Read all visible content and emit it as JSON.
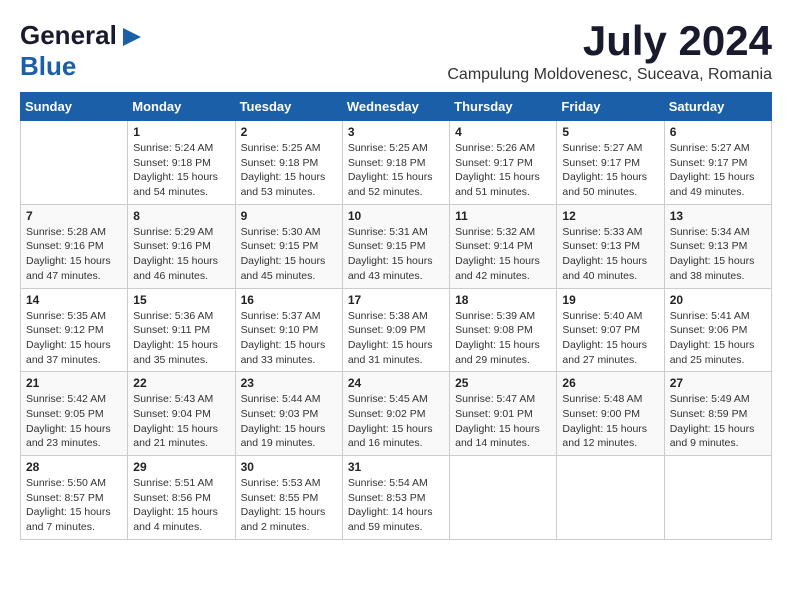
{
  "header": {
    "logo_general": "General",
    "logo_blue": "Blue",
    "title": "July 2024",
    "subtitle": "Campulung Moldovenesc, Suceava, Romania"
  },
  "calendar": {
    "days_of_week": [
      "Sunday",
      "Monday",
      "Tuesday",
      "Wednesday",
      "Thursday",
      "Friday",
      "Saturday"
    ],
    "weeks": [
      [
        {
          "day": "",
          "info": ""
        },
        {
          "day": "1",
          "info": "Sunrise: 5:24 AM\nSunset: 9:18 PM\nDaylight: 15 hours\nand 54 minutes."
        },
        {
          "day": "2",
          "info": "Sunrise: 5:25 AM\nSunset: 9:18 PM\nDaylight: 15 hours\nand 53 minutes."
        },
        {
          "day": "3",
          "info": "Sunrise: 5:25 AM\nSunset: 9:18 PM\nDaylight: 15 hours\nand 52 minutes."
        },
        {
          "day": "4",
          "info": "Sunrise: 5:26 AM\nSunset: 9:17 PM\nDaylight: 15 hours\nand 51 minutes."
        },
        {
          "day": "5",
          "info": "Sunrise: 5:27 AM\nSunset: 9:17 PM\nDaylight: 15 hours\nand 50 minutes."
        },
        {
          "day": "6",
          "info": "Sunrise: 5:27 AM\nSunset: 9:17 PM\nDaylight: 15 hours\nand 49 minutes."
        }
      ],
      [
        {
          "day": "7",
          "info": "Sunrise: 5:28 AM\nSunset: 9:16 PM\nDaylight: 15 hours\nand 47 minutes."
        },
        {
          "day": "8",
          "info": "Sunrise: 5:29 AM\nSunset: 9:16 PM\nDaylight: 15 hours\nand 46 minutes."
        },
        {
          "day": "9",
          "info": "Sunrise: 5:30 AM\nSunset: 9:15 PM\nDaylight: 15 hours\nand 45 minutes."
        },
        {
          "day": "10",
          "info": "Sunrise: 5:31 AM\nSunset: 9:15 PM\nDaylight: 15 hours\nand 43 minutes."
        },
        {
          "day": "11",
          "info": "Sunrise: 5:32 AM\nSunset: 9:14 PM\nDaylight: 15 hours\nand 42 minutes."
        },
        {
          "day": "12",
          "info": "Sunrise: 5:33 AM\nSunset: 9:13 PM\nDaylight: 15 hours\nand 40 minutes."
        },
        {
          "day": "13",
          "info": "Sunrise: 5:34 AM\nSunset: 9:13 PM\nDaylight: 15 hours\nand 38 minutes."
        }
      ],
      [
        {
          "day": "14",
          "info": "Sunrise: 5:35 AM\nSunset: 9:12 PM\nDaylight: 15 hours\nand 37 minutes."
        },
        {
          "day": "15",
          "info": "Sunrise: 5:36 AM\nSunset: 9:11 PM\nDaylight: 15 hours\nand 35 minutes."
        },
        {
          "day": "16",
          "info": "Sunrise: 5:37 AM\nSunset: 9:10 PM\nDaylight: 15 hours\nand 33 minutes."
        },
        {
          "day": "17",
          "info": "Sunrise: 5:38 AM\nSunset: 9:09 PM\nDaylight: 15 hours\nand 31 minutes."
        },
        {
          "day": "18",
          "info": "Sunrise: 5:39 AM\nSunset: 9:08 PM\nDaylight: 15 hours\nand 29 minutes."
        },
        {
          "day": "19",
          "info": "Sunrise: 5:40 AM\nSunset: 9:07 PM\nDaylight: 15 hours\nand 27 minutes."
        },
        {
          "day": "20",
          "info": "Sunrise: 5:41 AM\nSunset: 9:06 PM\nDaylight: 15 hours\nand 25 minutes."
        }
      ],
      [
        {
          "day": "21",
          "info": "Sunrise: 5:42 AM\nSunset: 9:05 PM\nDaylight: 15 hours\nand 23 minutes."
        },
        {
          "day": "22",
          "info": "Sunrise: 5:43 AM\nSunset: 9:04 PM\nDaylight: 15 hours\nand 21 minutes."
        },
        {
          "day": "23",
          "info": "Sunrise: 5:44 AM\nSunset: 9:03 PM\nDaylight: 15 hours\nand 19 minutes."
        },
        {
          "day": "24",
          "info": "Sunrise: 5:45 AM\nSunset: 9:02 PM\nDaylight: 15 hours\nand 16 minutes."
        },
        {
          "day": "25",
          "info": "Sunrise: 5:47 AM\nSunset: 9:01 PM\nDaylight: 15 hours\nand 14 minutes."
        },
        {
          "day": "26",
          "info": "Sunrise: 5:48 AM\nSunset: 9:00 PM\nDaylight: 15 hours\nand 12 minutes."
        },
        {
          "day": "27",
          "info": "Sunrise: 5:49 AM\nSunset: 8:59 PM\nDaylight: 15 hours\nand 9 minutes."
        }
      ],
      [
        {
          "day": "28",
          "info": "Sunrise: 5:50 AM\nSunset: 8:57 PM\nDaylight: 15 hours\nand 7 minutes."
        },
        {
          "day": "29",
          "info": "Sunrise: 5:51 AM\nSunset: 8:56 PM\nDaylight: 15 hours\nand 4 minutes."
        },
        {
          "day": "30",
          "info": "Sunrise: 5:53 AM\nSunset: 8:55 PM\nDaylight: 15 hours\nand 2 minutes."
        },
        {
          "day": "31",
          "info": "Sunrise: 5:54 AM\nSunset: 8:53 PM\nDaylight: 14 hours\nand 59 minutes."
        },
        {
          "day": "",
          "info": ""
        },
        {
          "day": "",
          "info": ""
        },
        {
          "day": "",
          "info": ""
        }
      ]
    ]
  }
}
